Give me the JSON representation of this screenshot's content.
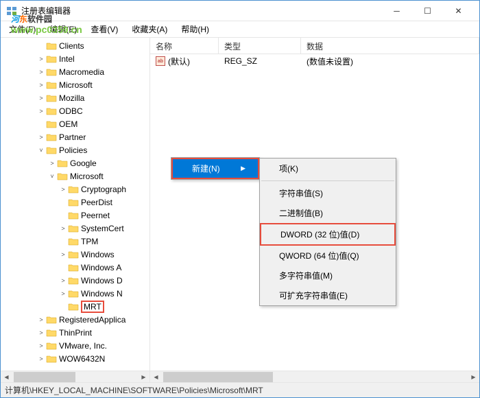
{
  "window": {
    "title": "注册表编辑器"
  },
  "watermark": {
    "text_main": "河东软件园",
    "url": "www.pc0359.cn"
  },
  "menu": {
    "file": "文件(F)",
    "edit": "编辑(E)",
    "view": "查看(V)",
    "favorites": "收藏夹(A)",
    "help": "帮助(H)"
  },
  "tree": [
    {
      "level": 3,
      "expander": "",
      "label": "Clients"
    },
    {
      "level": 3,
      "expander": ">",
      "label": "Intel"
    },
    {
      "level": 3,
      "expander": ">",
      "label": "Macromedia"
    },
    {
      "level": 3,
      "expander": ">",
      "label": "Microsoft"
    },
    {
      "level": 3,
      "expander": ">",
      "label": "Mozilla"
    },
    {
      "level": 3,
      "expander": ">",
      "label": "ODBC"
    },
    {
      "level": 3,
      "expander": "",
      "label": "OEM"
    },
    {
      "level": 3,
      "expander": ">",
      "label": "Partner"
    },
    {
      "level": 3,
      "expander": "v",
      "label": "Policies"
    },
    {
      "level": 4,
      "expander": ">",
      "label": "Google"
    },
    {
      "level": 4,
      "expander": "v",
      "label": "Microsoft"
    },
    {
      "level": 5,
      "expander": ">",
      "label": "Cryptograph"
    },
    {
      "level": 5,
      "expander": "",
      "label": "PeerDist"
    },
    {
      "level": 5,
      "expander": "",
      "label": "Peernet"
    },
    {
      "level": 5,
      "expander": ">",
      "label": "SystemCert"
    },
    {
      "level": 5,
      "expander": "",
      "label": "TPM"
    },
    {
      "level": 5,
      "expander": ">",
      "label": "Windows"
    },
    {
      "level": 5,
      "expander": "",
      "label": "Windows A"
    },
    {
      "level": 5,
      "expander": ">",
      "label": "Windows D"
    },
    {
      "level": 5,
      "expander": ">",
      "label": "Windows N"
    },
    {
      "level": 5,
      "expander": "",
      "label": "MRT",
      "highlighted": true
    },
    {
      "level": 3,
      "expander": ">",
      "label": "RegisteredApplica"
    },
    {
      "level": 3,
      "expander": ">",
      "label": "ThinPrint"
    },
    {
      "level": 3,
      "expander": ">",
      "label": "VMware, Inc."
    },
    {
      "level": 3,
      "expander": ">",
      "label": "WOW6432N"
    }
  ],
  "columns": {
    "name": "名称",
    "type": "类型",
    "data": "数据"
  },
  "col_widths": {
    "name": 100,
    "type": 120,
    "data": 200
  },
  "values": [
    {
      "name": "(默认)",
      "type": "REG_SZ",
      "data": "(数值未设置)"
    }
  ],
  "context_menu": {
    "new": "新建(N)",
    "sub": {
      "key": "项(K)",
      "string": "字符串值(S)",
      "binary": "二进制值(B)",
      "dword": "DWORD (32 位)值(D)",
      "qword": "QWORD (64 位)值(Q)",
      "multi": "多字符串值(M)",
      "expand": "可扩充字符串值(E)"
    }
  },
  "statusbar": {
    "path": "计算机\\HKEY_LOCAL_MACHINE\\SOFTWARE\\Policies\\Microsoft\\MRT"
  }
}
